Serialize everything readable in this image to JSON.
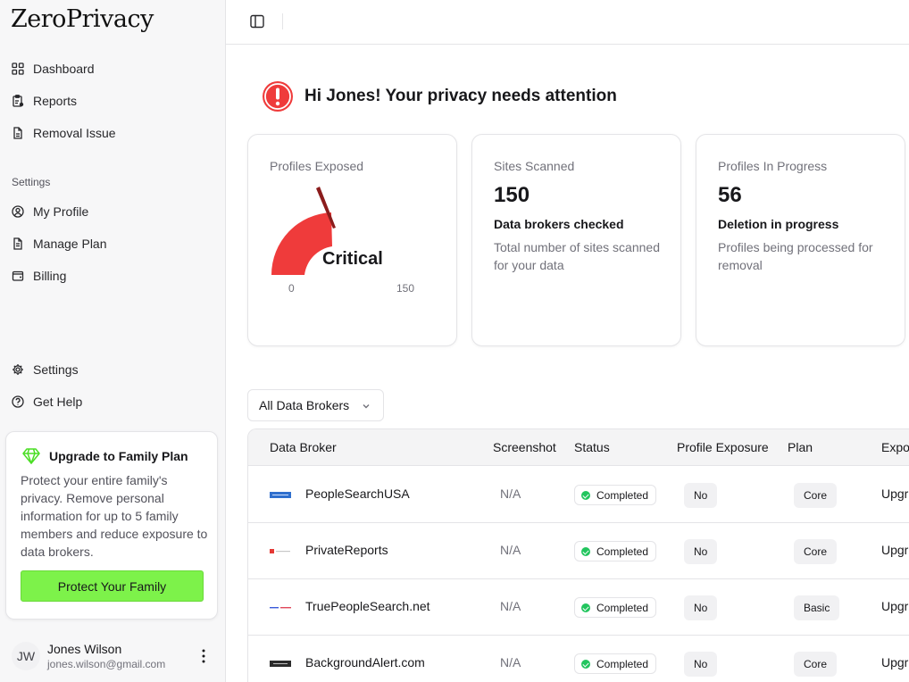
{
  "app": {
    "logo_text": "ZeroPrivacy"
  },
  "sidebar": {
    "nav_main": [
      {
        "label": "Dashboard",
        "icon": "grid-icon"
      },
      {
        "label": "Reports",
        "icon": "clipboard-icon"
      },
      {
        "label": "Removal Issue",
        "icon": "file-icon"
      }
    ],
    "settings_label": "Settings",
    "nav_settings": [
      {
        "label": "My Profile",
        "icon": "user-circle-icon"
      },
      {
        "label": "Manage Plan",
        "icon": "file-text-icon"
      },
      {
        "label": "Billing",
        "icon": "wallet-icon"
      }
    ],
    "nav_bottom": [
      {
        "label": "Settings",
        "icon": "gear-icon"
      },
      {
        "label": "Get Help",
        "icon": "help-circle-icon"
      }
    ],
    "upgrade": {
      "title": "Upgrade to Family Plan",
      "text": "Protect your entire family's privacy. Remove personal information for up to 5 family members and reduce exposure to data brokers.",
      "button": "Protect Your Family"
    },
    "user": {
      "initials": "JW",
      "name": "Jones Wilson",
      "email": "jones.wilson@gmail.com"
    }
  },
  "main": {
    "greeting": "Hi Jones! Your privacy needs attention",
    "cards": {
      "exposed": {
        "label": "Profiles Exposed",
        "status": "Critical",
        "min": "0",
        "max": "150"
      },
      "scanned": {
        "label": "Sites Scanned",
        "value": "150",
        "subtitle": "Data brokers checked",
        "description": "Total number of sites scanned for your data"
      },
      "progress": {
        "label": "Profiles In Progress",
        "value": "56",
        "subtitle": "Deletion in progress",
        "description": "Profiles being processed for removal"
      }
    },
    "filter": {
      "selected": "All Data Brokers"
    },
    "table": {
      "headers": {
        "broker": "Data Broker",
        "screenshot": "Screenshot",
        "status": "Status",
        "exposure": "Profile Exposure",
        "plan": "Plan",
        "export": "Expo"
      },
      "rows": [
        {
          "broker": "PeopleSearchUSA",
          "screenshot": "N/A",
          "status": "Completed",
          "exposure": "No",
          "plan": "Core",
          "export": "Upgr"
        },
        {
          "broker": "PrivateReports",
          "screenshot": "N/A",
          "status": "Completed",
          "exposure": "No",
          "plan": "Core",
          "export": "Upgr"
        },
        {
          "broker": "TruePeopleSearch.net",
          "screenshot": "N/A",
          "status": "Completed",
          "exposure": "No",
          "plan": "Basic",
          "export": "Upgr"
        },
        {
          "broker": "BackgroundAlert.com",
          "screenshot": "N/A",
          "status": "Completed",
          "exposure": "No",
          "plan": "Core",
          "export": "Upgr"
        }
      ]
    }
  },
  "colors": {
    "accent_green": "#7df24a",
    "critical_red": "#ef3b3b",
    "status_green": "#22c55e"
  }
}
